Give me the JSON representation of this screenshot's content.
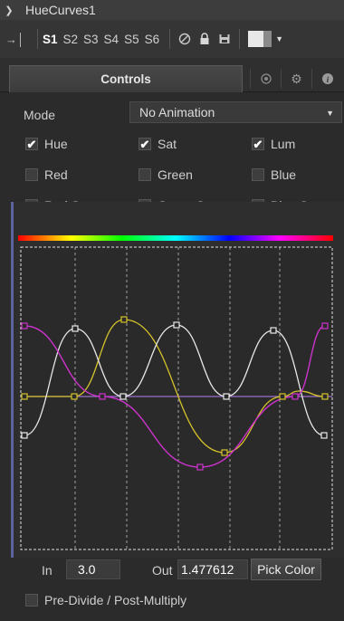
{
  "header": {
    "title": "HueCurves1",
    "collapse_icon": "chevron-down-icon"
  },
  "toolbar": {
    "slots": [
      "S1",
      "S2",
      "S3",
      "S4",
      "S5",
      "S6"
    ],
    "active_slot": "S1",
    "icons": [
      "pin-icon",
      "disable-icon",
      "lock-icon",
      "save-icon",
      "color-swatch-icon"
    ]
  },
  "tabs": {
    "controls_label": "Controls",
    "icons": [
      "modifiers-icon",
      "settings-icon",
      "info-icon"
    ]
  },
  "mode": {
    "label": "Mode",
    "value": "No Animation"
  },
  "checkboxes": {
    "hue": {
      "label": "Hue",
      "checked": true
    },
    "sat": {
      "label": "Sat",
      "checked": true
    },
    "lum": {
      "label": "Lum",
      "checked": true
    },
    "red": {
      "label": "Red",
      "checked": false
    },
    "green": {
      "label": "Green",
      "checked": false
    },
    "blue": {
      "label": "Blue",
      "checked": false
    },
    "red_suppress": {
      "label": "Red Suppres:",
      "checked": false
    },
    "green_suppress": {
      "label": "Green Suppr",
      "checked": false
    },
    "blue_suppress": {
      "label": "Blue Suppre",
      "checked": false
    },
    "predivide": {
      "label": "Pre-Divide / Post-Multiply",
      "checked": false
    }
  },
  "curves": {
    "colors": {
      "hue": "#cc33cc",
      "sat": "#e8e8e8",
      "lum": "#d4c22a",
      "flat": "#9b6fc9"
    }
  },
  "io": {
    "in_label": "In",
    "in_value": "3.0",
    "out_label": "Out",
    "out_value": "1.477612",
    "pick_label": "Pick Color"
  }
}
